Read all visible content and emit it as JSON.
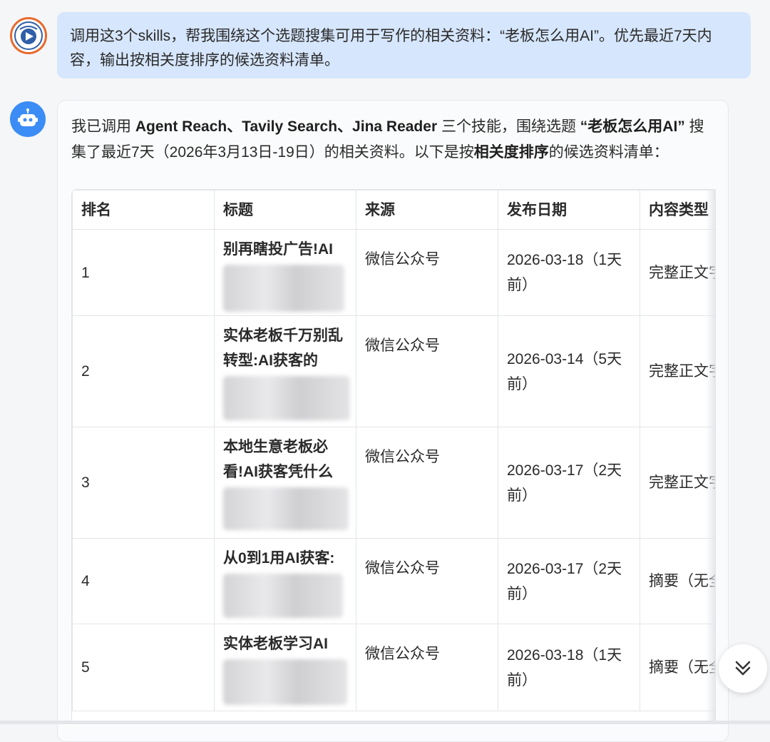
{
  "user_message": "调用这3个skills，帮我围绕这个选题搜集可用于写作的相关资料：“老板怎么用AI”。优先最近7天内容，输出按相关度排序的候选资料清单。",
  "bot_intro": {
    "p1": "我已调用 ",
    "skills": "Agent Reach、Tavily Search、Jina Reader",
    "p2": " 三个技能，围绕选题 ",
    "topic": "“老板怎么用AI”",
    "p3": " 搜集了最近7天（2026年3月13日-19日）的相关资料。以下是按",
    "emph": "相关度排序",
    "p4": "的候选资料清单："
  },
  "table": {
    "headers": [
      "排名",
      "标题",
      "来源",
      "发布日期",
      "内容类型"
    ],
    "rows": [
      {
        "rank": "1",
        "title": "别再瞎投广告!AI",
        "source": "微信公众号",
        "date": "2026-03-18（1天前）",
        "type": "完整正文字）"
      },
      {
        "rank": "2",
        "title": "实体老板千万别乱转型:AI获客的",
        "source": "微信公众号",
        "date": "2026-03-14（5天前）",
        "type": "完整正文字）"
      },
      {
        "rank": "3",
        "title": "本地生意老板必看!AI获客凭什么",
        "source": "微信公众号",
        "date": "2026-03-17（2天前）",
        "type": "完整正文字）"
      },
      {
        "rank": "4",
        "title": "从0到1用AI获客:",
        "source": "微信公众号",
        "date": "2026-03-17（2天前）",
        "type": "摘要（无全"
      },
      {
        "rank": "5",
        "title": "实体老板学习AI",
        "source": "微信公众号",
        "date": "2026-03-18（1天前）",
        "type": "摘要（无全"
      }
    ]
  },
  "icons": {
    "user_avatar": "logo-avatar",
    "bot_avatar": "robot-icon",
    "scroll": "double-chevron-down-icon"
  },
  "colors": {
    "user_bubble": "#d6e6fc",
    "bot_avatar": "#3b8cf5",
    "user_avatar_ring": "#e8692b"
  }
}
